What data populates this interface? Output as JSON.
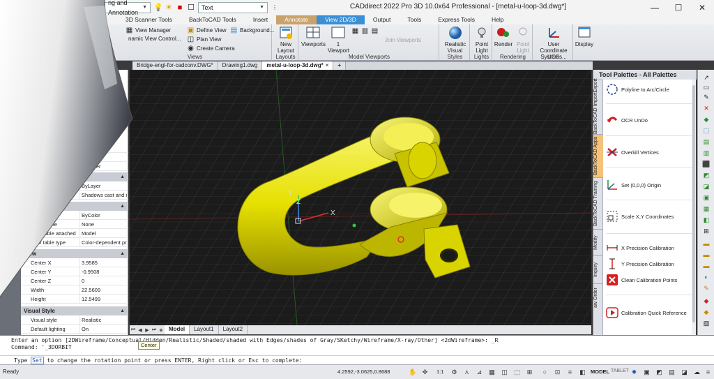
{
  "window": {
    "title": "CADdirect 2022 Pro 3D 10.0x64 Professional - [metal-u-loop-3d.dwg*]",
    "controls": [
      "—",
      "☐",
      "✕"
    ]
  },
  "qat": {
    "workspace": "ng and Annotation",
    "text_style": "Text"
  },
  "menu": {
    "tabs": [
      "3D Scanner Tools",
      "BackToCAD Tools",
      "Insert",
      "Annotate",
      "View 2D/3D",
      "Output",
      "Tools",
      "Express Tools",
      "Help"
    ]
  },
  "ribbon": {
    "views": {
      "label": "Views",
      "view_manager": "View Manager",
      "dynamic_view": "namic View Control...",
      "define_view": "Define View",
      "plan_view": "Plan View",
      "create_camera": "Create Camera",
      "background": "Background..."
    },
    "layouts": {
      "label": "Layouts",
      "new_layout": "New Layout"
    },
    "viewports": {
      "label": "Model Viewports",
      "viewports": "Viewports",
      "one_viewport": "1 Viewport",
      "join": "Join Viewports"
    },
    "visual_styles": {
      "label": "Visual Styles",
      "realistic": "Realistic"
    },
    "lights": {
      "label": "Lights",
      "point_light": "Point Light"
    },
    "rendering": {
      "label": "Rendering",
      "render": "Render",
      "point_light": "Point Light"
    },
    "ucs": {
      "label": "UCS",
      "user_coord": "User Coordinate Systems..."
    },
    "display": {
      "label": "Display"
    }
  },
  "doc_tabs": [
    {
      "label": "Bridge-engl-for-cadconv.DWG*"
    },
    {
      "label": "Drawing1.dwg"
    },
    {
      "label": "metal-u-loop-3d.dwg*",
      "active": true
    }
  ],
  "properties": {
    "rows_top": [
      {
        "key": "",
        "value": "ByLayer"
      },
      {
        "key": "",
        "value": ""
      },
      {
        "key": "",
        "value": "ByLayer"
      }
    ],
    "shadow_rows": [
      {
        "key": "",
        "value": "ByLayer"
      },
      {
        "key": "ay",
        "value": "Shadows cast and r..."
      }
    ],
    "plot_rows": [
      {
        "key": "style",
        "value": "ByColor"
      },
      {
        "key": "t style table",
        "value": "None"
      },
      {
        "key": "Print table attached to",
        "value": "Model"
      },
      {
        "key": "Print table type",
        "value": "Color-dependent prin..."
      }
    ],
    "view_section": "View",
    "view_rows": [
      {
        "key": "Center X",
        "value": "3.9585"
      },
      {
        "key": "Center Y",
        "value": "-0.9508"
      },
      {
        "key": "Center Z",
        "value": "0"
      },
      {
        "key": "Width",
        "value": "22.5609"
      },
      {
        "key": "Height",
        "value": "12.5499"
      }
    ],
    "visual_section": "Visual Style",
    "visual_rows": [
      {
        "key": "Visual style",
        "value": "Realistic"
      },
      {
        "key": "Default lighting",
        "value": "On"
      }
    ]
  },
  "viewport": {
    "axis_x": "X",
    "axis_y": "Y",
    "axis_z": "Z",
    "model_color": "#e6e000",
    "background": "#1b1b1b"
  },
  "layout_tabs": [
    "Model",
    "Layout1",
    "Layout2"
  ],
  "palette": {
    "title": "Tool Palettes - All Palettes",
    "side_tabs": [
      "BackToCAD ImportExport",
      "BackToCAD Apps",
      "BackToCAD Training",
      "Modify",
      "Inquiry",
      "aw Order"
    ],
    "items": [
      {
        "label": "Polyline to Arc/Circle",
        "icon": "polyline-arc-icon"
      },
      {
        "label": "OCR UnDo",
        "icon": "ocr-undo-icon"
      },
      {
        "label": "Overkill Vertices",
        "icon": "overkill-icon"
      },
      {
        "label": "Set (0,0,0) Origin",
        "icon": "origin-icon"
      },
      {
        "label": "Scale X,Y Coordinates",
        "icon": "scale-icon"
      },
      {
        "label": "X Precision Calibration",
        "icon": "x-calibration-icon"
      },
      {
        "label": "Y Precision Calibration",
        "icon": "y-calibration-icon"
      },
      {
        "label": "Clean Calibration Points",
        "icon": "clean-calibration-icon"
      },
      {
        "label": "Calibration Quick Reference",
        "icon": "video-icon"
      }
    ]
  },
  "command": {
    "line1": "Enter an option [2DWireframe/Conceptual/Hidden/Realistic/Shaded/shaded with Edges/shades of Gray/SKetchy/Wireframe/X-ray/Other] <2dWireframe>: _R",
    "line2": "Command: '_3DORBIT",
    "tooltip": "Center",
    "prompt_pre": "Type",
    "prompt_kw": "Set",
    "prompt_post": "to change the rotation point or press ENTER, Right click or Esc to complete:"
  },
  "status": {
    "ready": "Ready",
    "coords": "4.2592,-3.0625,0.8688",
    "scale": "1:1",
    "model": "MODEL",
    "tablet": "TABLET"
  }
}
